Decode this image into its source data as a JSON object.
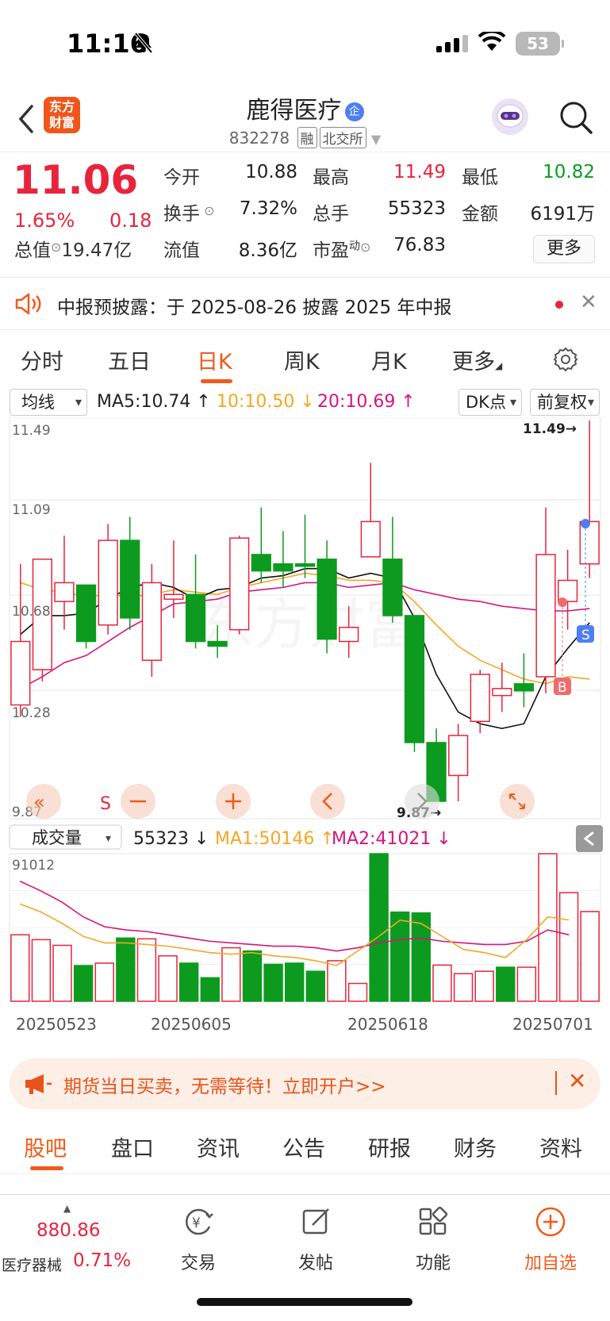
{
  "status_bar": {
    "time": "11:16",
    "battery": "53"
  },
  "header": {
    "back_icon": "chevron-left-icon",
    "logo_text": [
      "东方",
      "财富"
    ],
    "stock_name": "鹿得医疗",
    "badge": "企",
    "code": "832278",
    "tags": [
      "融",
      "北交所"
    ]
  },
  "quote": {
    "price": "11.06",
    "pct": "1.65%",
    "change": "0.18",
    "rows": [
      [
        {
          "label": "今开",
          "value": "10.88",
          "color": "#222"
        },
        {
          "label": "最高",
          "value": "11.49",
          "color": "#e8243d"
        },
        {
          "label": "最低",
          "value": "10.82",
          "color": "#0c9b1e"
        }
      ],
      [
        {
          "label": "换手",
          "value": "7.32%",
          "color": "#222"
        },
        {
          "label": "总手",
          "value": "55323",
          "color": "#222"
        },
        {
          "label": "金额",
          "value": "6191万",
          "color": "#222"
        }
      ],
      [
        {
          "label": "总值",
          "value": "19.47亿",
          "color": "#222"
        },
        {
          "label": "流值",
          "value": "8.36亿",
          "color": "#222"
        },
        {
          "label": "市盈",
          "sup": "动",
          "value": "76.83",
          "color": "#222"
        }
      ]
    ],
    "more_label": "更多"
  },
  "notice": {
    "text": "中报预披露：于 2025-08-26 披露 2025 年中报"
  },
  "chart_tabs": [
    "分时",
    "五日",
    "日K",
    "周K",
    "月K",
    "更多"
  ],
  "chart_tab_active": 2,
  "ma_legend": {
    "selector": "均线",
    "ma5": "MA5:10.74 ↑",
    "ma10": "10:10.50 ↓",
    "ma20": "20:10.69 ↑",
    "dk": "DK点",
    "adjust": "前复权"
  },
  "kline": {
    "axis_labels": [
      "11.49",
      "11.09",
      "10.68",
      "10.28",
      "9.87"
    ],
    "high_label": "11.49→",
    "low_label": "9.87→",
    "watermark": "东方财富"
  },
  "volume": {
    "selector": "成交量",
    "legend_value": "55323 ↓",
    "ma1": "MA1:50146 ↑",
    "ma2": "MA2:41021 ↓",
    "top_label": "91012",
    "dates": [
      "20250523",
      "20250605",
      "20250618",
      "20250701"
    ]
  },
  "chart_data": {
    "type": "candlestick",
    "ylim": [
      9.87,
      11.49
    ],
    "candles": [
      {
        "o": 10.28,
        "c": 10.55,
        "h": 10.88,
        "l": 10.23
      },
      {
        "o": 10.43,
        "c": 10.9,
        "h": 10.9,
        "l": 10.38
      },
      {
        "o": 10.72,
        "c": 10.8,
        "h": 11.0,
        "l": 10.6
      },
      {
        "o": 10.79,
        "c": 10.55,
        "h": 10.79,
        "l": 10.52
      },
      {
        "o": 10.62,
        "c": 10.98,
        "h": 11.05,
        "l": 10.58
      },
      {
        "o": 10.98,
        "c": 10.65,
        "h": 11.08,
        "l": 10.6
      },
      {
        "o": 10.47,
        "c": 10.8,
        "h": 10.88,
        "l": 10.4
      },
      {
        "o": 10.73,
        "c": 10.75,
        "h": 10.98,
        "l": 10.65
      },
      {
        "o": 10.75,
        "c": 10.55,
        "h": 10.92,
        "l": 10.52
      },
      {
        "o": 10.55,
        "c": 10.53,
        "h": 10.62,
        "l": 10.48
      },
      {
        "o": 10.6,
        "c": 10.99,
        "h": 11.0,
        "l": 10.58
      },
      {
        "o": 10.92,
        "c": 10.85,
        "h": 11.12,
        "l": 10.8
      },
      {
        "o": 10.88,
        "c": 10.85,
        "h": 11.02,
        "l": 10.78
      },
      {
        "o": 10.88,
        "c": 10.87,
        "h": 11.09,
        "l": 10.82
      },
      {
        "o": 10.9,
        "c": 10.56,
        "h": 10.98,
        "l": 10.5
      },
      {
        "o": 10.55,
        "c": 10.61,
        "h": 10.7,
        "l": 10.48
      },
      {
        "o": 10.91,
        "c": 11.06,
        "h": 11.31,
        "l": 10.91
      },
      {
        "o": 10.9,
        "c": 10.66,
        "h": 11.08,
        "l": 10.63
      },
      {
        "o": 10.66,
        "c": 10.12,
        "h": 10.66,
        "l": 10.08
      },
      {
        "o": 10.12,
        "c": 9.87,
        "h": 10.18,
        "l": 9.87
      },
      {
        "o": 9.98,
        "c": 10.15,
        "h": 10.2,
        "l": 9.87
      },
      {
        "o": 10.21,
        "c": 10.41,
        "h": 10.43,
        "l": 10.16
      },
      {
        "o": 10.32,
        "c": 10.35,
        "h": 10.46,
        "l": 10.25
      },
      {
        "o": 10.37,
        "c": 10.34,
        "h": 10.5,
        "l": 10.27
      },
      {
        "o": 10.4,
        "c": 10.92,
        "h": 11.12,
        "l": 10.33
      },
      {
        "o": 10.72,
        "c": 10.81,
        "h": 10.94,
        "l": 10.6
      },
      {
        "o": 10.88,
        "c": 11.06,
        "h": 11.49,
        "l": 10.82
      }
    ],
    "ma5": [
      10.58,
      10.66,
      10.66,
      10.67,
      10.73,
      10.78,
      10.8,
      10.78,
      10.73,
      10.77,
      10.78,
      10.82,
      10.83,
      10.86,
      10.86,
      10.82,
      10.84,
      10.82,
      10.65,
      10.41,
      10.25,
      10.2,
      10.18,
      10.2,
      10.4,
      10.52,
      10.63
    ],
    "ma10": [
      10.8,
      10.77,
      10.76,
      10.74,
      10.75,
      10.74,
      10.75,
      10.77,
      10.76,
      10.75,
      10.78,
      10.8,
      10.82,
      10.84,
      10.83,
      10.81,
      10.81,
      10.8,
      10.72,
      10.62,
      10.53,
      10.47,
      10.43,
      10.39,
      10.37,
      10.4,
      10.39
    ],
    "ma20": [
      10.35,
      10.4,
      10.46,
      10.49,
      10.55,
      10.61,
      10.66,
      10.71,
      10.72,
      10.73,
      10.76,
      10.77,
      10.78,
      10.8,
      10.8,
      10.78,
      10.79,
      10.8,
      10.77,
      10.75,
      10.73,
      10.72,
      10.7,
      10.69,
      10.68,
      10.68,
      10.69
    ],
    "volume": [
      41000,
      38000,
      34500,
      22000,
      23500,
      39000,
      38500,
      28000,
      23500,
      14500,
      33000,
      31000,
      22800,
      23500,
      18500,
      25000,
      11000,
      91012,
      55000,
      54500,
      22300,
      17000,
      18500,
      21000,
      21000,
      91000,
      67000,
      55323
    ],
    "vol_ma1": [
      60000,
      55000,
      48000,
      40000,
      36000,
      36000,
      35000,
      34000,
      32000,
      30000,
      29000,
      30000,
      28000,
      27000,
      25000,
      22000,
      31000,
      40000,
      50000,
      48000,
      40000,
      32000,
      30000,
      27000,
      38000,
      52000,
      50146
    ],
    "vol_ma2": [
      74000,
      68000,
      61000,
      52000,
      46000,
      44000,
      43000,
      41000,
      39000,
      37000,
      36000,
      35000,
      34000,
      34000,
      33000,
      31000,
      33000,
      36000,
      38000,
      39000,
      37000,
      36000,
      35000,
      35000,
      37000,
      44000,
      41021
    ]
  },
  "banner": {
    "text": "期货当日买卖，无需等待！立即开户>>"
  },
  "bottom_tabs": [
    "股吧",
    "盘口",
    "资讯",
    "公告",
    "研报",
    "财务",
    "资料"
  ],
  "bottom_nav": {
    "index_value": "880.86",
    "index_name": "医疗器械",
    "index_pct": "0.71%",
    "items": [
      {
        "label": "交易",
        "icon": "yen-cycle-icon"
      },
      {
        "label": "发帖",
        "icon": "edit-icon"
      },
      {
        "label": "功能",
        "icon": "grid-icon"
      },
      {
        "label": "加自选",
        "icon": "plus-circle-icon"
      }
    ]
  }
}
